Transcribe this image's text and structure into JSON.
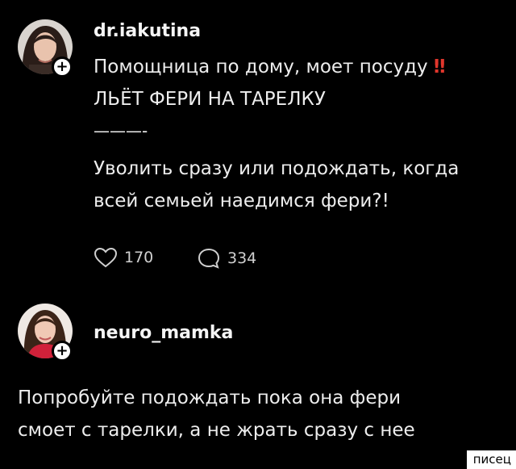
{
  "post1": {
    "username": "dr.iakutina",
    "line1": "Помощница по дому, моет посуду",
    "line1_emoji": "‼",
    "line2": "ЛЬЁТ ФЕРИ НА ТАРЕЛКУ",
    "divider": "———-",
    "line3": "Уволить сразу или подождать, когда",
    "line4": "всей семьей наедимся фери?!",
    "likes": "170",
    "comments": "334"
  },
  "post2": {
    "username": "neuro_mamka",
    "line1": "Попробуйте подождать пока она фери",
    "line2": "смоет с тарелки, а не жрать сразу с нее"
  },
  "watermark": "писец",
  "colors": {
    "background": "#000000",
    "text": "#ededed",
    "emoji_red": "#e0362c"
  }
}
